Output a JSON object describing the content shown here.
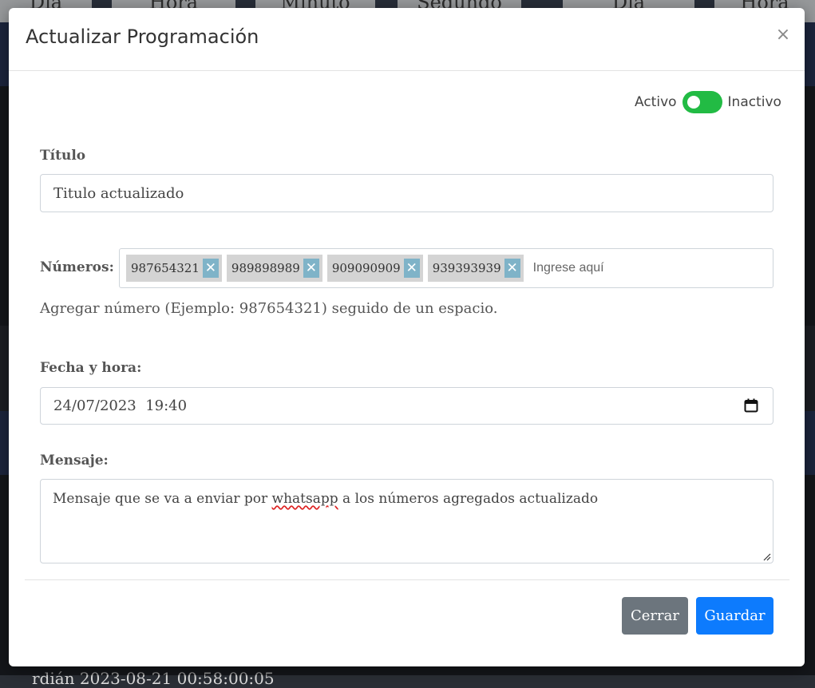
{
  "background": {
    "header_cells": [
      "Día",
      "Hora",
      "Minuto",
      "Segundo",
      "Día",
      "Hora"
    ],
    "footer_text": "rdián 2023-08-21 00:58:00:05"
  },
  "modal": {
    "title": "Actualizar Programación",
    "close_label": "×",
    "status": {
      "active_label": "Activo",
      "inactive_label": "Inactivo",
      "toggle_state": "on",
      "toggle_color": "#22bb44"
    },
    "titulo": {
      "label": "Título",
      "value": "Titulo actualizado"
    },
    "numeros": {
      "label": "Números:",
      "tags": [
        "987654321",
        "989898989",
        "909090909",
        "939393939"
      ],
      "remove_label": "✕",
      "input_placeholder": "Ingrese aquí",
      "hint": "Agregar número (Ejemplo: 987654321) seguido de un espacio."
    },
    "fecha": {
      "label": "Fecha y hora:",
      "value": "24/07/2023  19:40",
      "icon": "calendar-icon"
    },
    "mensaje": {
      "label": "Mensaje:",
      "value_before": "Mensaje que se va a enviar por ",
      "value_misspelled": "whatsapp",
      "value_after": " a los números agregados actualizado"
    },
    "buttons": {
      "close_label": "Cerrar",
      "save_label": "Guardar",
      "close_color": "#6c757d",
      "save_color": "#0d7bfd"
    }
  }
}
